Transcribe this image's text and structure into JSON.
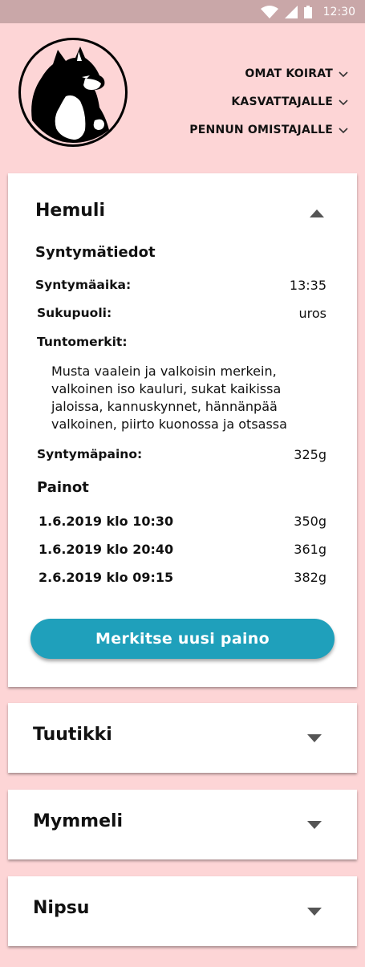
{
  "status_bar": {
    "time": "12:30"
  },
  "nav": [
    {
      "label": "OMAT KOIRAT"
    },
    {
      "label": "KASVATTAJALLE"
    },
    {
      "label": "PENNUN OMISTAJALLE"
    }
  ],
  "expanded_puppy": {
    "name": "Hemuli",
    "birth_section": "Syntymätiedot",
    "fields": {
      "birth_time_label": "Syntymäaika:",
      "birth_time_value": "13:35",
      "sex_label": "Sukupuoli:",
      "sex_value": "uros",
      "markings_label": "Tuntomerkit:",
      "markings_value": "Musta vaalein ja valkoisin merkein, valkoinen iso kauluri, sukat kaikissa jaloissa, kannuskynnet, hännänpää valkoinen, piirto kuonossa ja otsassa",
      "birth_weight_label": "Syntymäpaino:",
      "birth_weight_value": "325g"
    },
    "weights_section": "Painot",
    "weights": [
      {
        "date": "1.6.2019 klo 10:30",
        "weight": "350g"
      },
      {
        "date": "1.6.2019 klo 20:40",
        "weight": "361g"
      },
      {
        "date": "2.6.2019 klo 09:15",
        "weight": "382g"
      }
    ],
    "button_label": "Merkitse uusi paino"
  },
  "collapsed_puppies": [
    {
      "name": "Tuutikki"
    },
    {
      "name": "Mymmeli"
    },
    {
      "name": "Nipsu"
    }
  ],
  "colors": {
    "background": "#fdd5d6",
    "status_bar": "#c9a7a8",
    "button": "#1fa0bb",
    "card": "#ffffff"
  },
  "icons": {
    "logo": "dog-logo-icon",
    "expand": "triangle-down-icon",
    "collapse": "triangle-up-icon",
    "nav_chevron": "chevron-down-icon"
  }
}
